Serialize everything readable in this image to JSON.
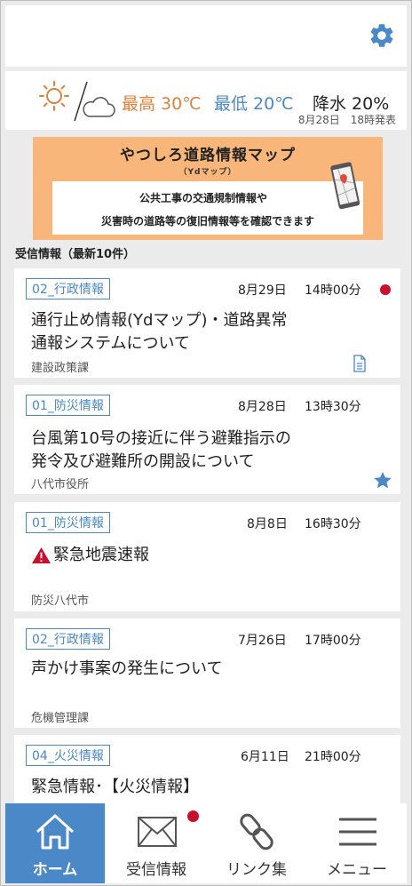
{
  "icons": {
    "settings": "gear-icon",
    "weather_day": "sun-icon",
    "weather_night": "cloud-icon",
    "document": "document-icon",
    "favorite": "star-icon",
    "warning": "warning-icon",
    "home": "home-icon",
    "mail": "mail-icon",
    "link": "link-icon",
    "menu": "menu-icon"
  },
  "colors": {
    "accent": "#4a88c7",
    "high_temp": "#e0813b",
    "low_temp": "#4a88c7",
    "banner_bg": "#f9b67a",
    "alert_dot": "#c8102e"
  },
  "weather": {
    "high": "最高 30℃",
    "low": "最低 20℃",
    "rain": "降水 20%",
    "issued": "8月28日　18時発表"
  },
  "banner": {
    "title": "やつしろ道路情報マップ",
    "subtitle": "（Ydマップ）",
    "line1": "公共工事の交通規制情報や",
    "line2": "災害時の道路等の復旧情報等を確認できます"
  },
  "section": {
    "label": "受信情報（最新10件）"
  },
  "messages": [
    {
      "category": "02_行政情報",
      "date": "8月29日",
      "time": "14時00分",
      "title_line1": "通行止め情報(Ydマップ)・道路異常",
      "title_line2": "通報システムについて",
      "source": "建設政策課",
      "unread": true,
      "icon": "document-icon"
    },
    {
      "category": "01_防災情報",
      "date": "8月28日",
      "time": "13時30分",
      "title_line1": "台風第10号の接近に伴う避難指示の",
      "title_line2": "発令及び避難所の開設について",
      "source": "八代市役所",
      "icon": "star-icon"
    },
    {
      "category": "01_防災情報",
      "date": "8月8日",
      "time": "16時30分",
      "title_line1": "緊急地震速報",
      "source": "防災八代市",
      "icon": "warning-icon"
    },
    {
      "category": "02_行政情報",
      "date": "7月26日",
      "time": "17時00分",
      "title_line1": "声かけ事案の発生について",
      "source": "危機管理課"
    },
    {
      "category": "04_火災情報",
      "date": "6月11日",
      "time": "21時00分",
      "title_line1": "緊急情報･【火災情報】"
    }
  ],
  "nav": {
    "home": "ホーム",
    "inbox": "受信情報",
    "links": "リンク集",
    "menu": "メニュー",
    "inbox_has_new": true
  }
}
